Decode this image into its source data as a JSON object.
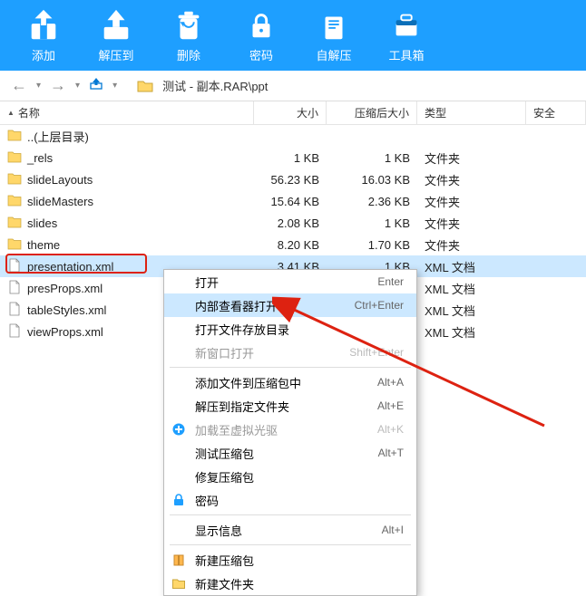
{
  "toolbar": {
    "items": [
      {
        "label": "添加",
        "icon": "add-archive-icon"
      },
      {
        "label": "解压到",
        "icon": "extract-icon"
      },
      {
        "label": "删除",
        "icon": "trash-icon"
      },
      {
        "label": "密码",
        "icon": "lock-icon"
      },
      {
        "label": "自解压",
        "icon": "sfx-icon"
      },
      {
        "label": "工具箱",
        "icon": "toolbox-icon"
      }
    ]
  },
  "address": {
    "path": "测试 - 副本.RAR\\ppt"
  },
  "columns": {
    "name": "名称",
    "size": "大小",
    "csize": "压缩后大小",
    "type": "类型",
    "safe": "安全"
  },
  "rows": [
    {
      "icon": "folder",
      "name": "..(上层目录)",
      "size": "",
      "csize": "",
      "type": ""
    },
    {
      "icon": "folder",
      "name": "_rels",
      "size": "1 KB",
      "csize": "1 KB",
      "type": "文件夹"
    },
    {
      "icon": "folder",
      "name": "slideLayouts",
      "size": "56.23 KB",
      "csize": "16.03 KB",
      "type": "文件夹"
    },
    {
      "icon": "folder",
      "name": "slideMasters",
      "size": "15.64 KB",
      "csize": "2.36 KB",
      "type": "文件夹"
    },
    {
      "icon": "folder",
      "name": "slides",
      "size": "2.08 KB",
      "csize": "1 KB",
      "type": "文件夹"
    },
    {
      "icon": "folder",
      "name": "theme",
      "size": "8.20 KB",
      "csize": "1.70 KB",
      "type": "文件夹"
    },
    {
      "icon": "file",
      "name": "presentation.xml",
      "size": "3.41 KB",
      "csize": "1 KB",
      "type": "XML 文档",
      "selected": true,
      "boxed": true
    },
    {
      "icon": "file",
      "name": "presProps.xml",
      "size": "",
      "csize": "",
      "type": "XML 文档"
    },
    {
      "icon": "file",
      "name": "tableStyles.xml",
      "size": "",
      "csize": "",
      "type": "XML 文档"
    },
    {
      "icon": "file",
      "name": "viewProps.xml",
      "size": "",
      "csize": "",
      "type": "XML 文档"
    }
  ],
  "context_menu": {
    "groups": [
      [
        {
          "label": "打开",
          "shortcut": "Enter"
        },
        {
          "label": "内部查看器打开",
          "shortcut": "Ctrl+Enter",
          "selected": true
        },
        {
          "label": "打开文件存放目录"
        },
        {
          "label": "新窗口打开",
          "shortcut": "Shift+Enter",
          "disabled": true
        }
      ],
      [
        {
          "label": "添加文件到压缩包中",
          "shortcut": "Alt+A"
        },
        {
          "label": "解压到指定文件夹",
          "shortcut": "Alt+E"
        },
        {
          "label": "加载至虚拟光驱",
          "shortcut": "Alt+K",
          "disabled": true,
          "icon": "plus"
        },
        {
          "label": "测试压缩包",
          "shortcut": "Alt+T"
        },
        {
          "label": "修复压缩包"
        },
        {
          "label": "密码",
          "icon": "lock"
        }
      ],
      [
        {
          "label": "显示信息",
          "shortcut": "Alt+I"
        }
      ],
      [
        {
          "label": "新建压缩包",
          "icon": "archive"
        },
        {
          "label": "新建文件夹",
          "icon": "folder"
        }
      ]
    ]
  }
}
